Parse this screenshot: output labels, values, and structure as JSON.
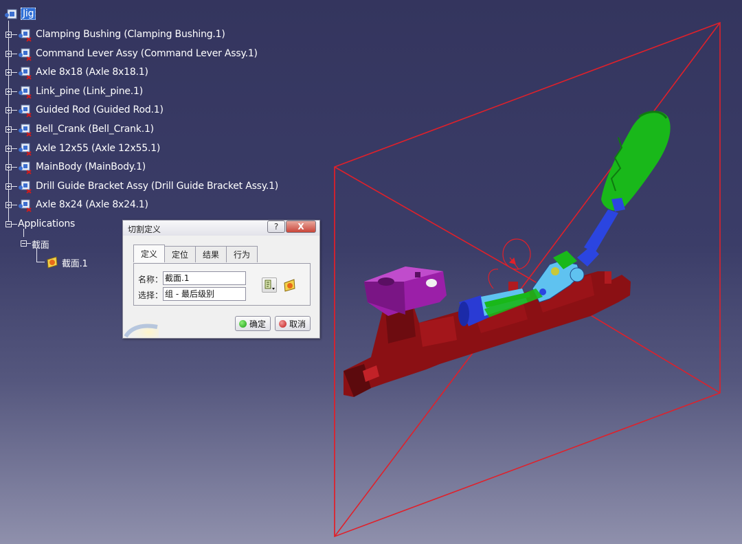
{
  "tree": {
    "root": {
      "label": "Jig"
    },
    "items": [
      {
        "label": "Clamping Bushing (Clamping Bushing.1)"
      },
      {
        "label": "Command Lever Assy (Command Lever Assy.1)"
      },
      {
        "label": "Axle 8x18 (Axle 8x18.1)"
      },
      {
        "label": "Link_pine (Link_pine.1)"
      },
      {
        "label": "Guided Rod (Guided Rod.1)"
      },
      {
        "label": "Bell_Crank (Bell_Crank.1)"
      },
      {
        "label": "Axle 12x55 (Axle 12x55.1)"
      },
      {
        "label": "MainBody (MainBody.1)"
      },
      {
        "label": "Drill Guide Bracket Assy (Drill Guide Bracket Assy.1)"
      },
      {
        "label": "Axle 8x24 (Axle 8x24.1)"
      }
    ],
    "applications": {
      "label": "Applications",
      "section_group": {
        "label": "截面"
      },
      "section_item": {
        "label": "截面.1"
      }
    }
  },
  "dialog": {
    "title": "切割定义",
    "help_label": "?",
    "close_label": "X",
    "tabs": [
      {
        "label": "定义"
      },
      {
        "label": "定位"
      },
      {
        "label": "结果"
      },
      {
        "label": "行为"
      }
    ],
    "name_label": "名称：",
    "name_value": "截面.1",
    "selection_label": "选择：",
    "selection_value": "组 - 最后级别",
    "ok_label": "确定",
    "cancel_label": "取消"
  },
  "colors": {
    "background_top": "#34355e",
    "section_plane": "#e0202a",
    "main_body": "#8b1014",
    "clamp": "#9b1fa8",
    "lever": "#19b81a",
    "link": "#2b45e0",
    "bell_crank": "#5fc2f0"
  },
  "icons": {
    "part": "product-part-icon",
    "section": "section-icon",
    "ok": "green-dot-icon",
    "cancel": "red-dot-icon"
  }
}
